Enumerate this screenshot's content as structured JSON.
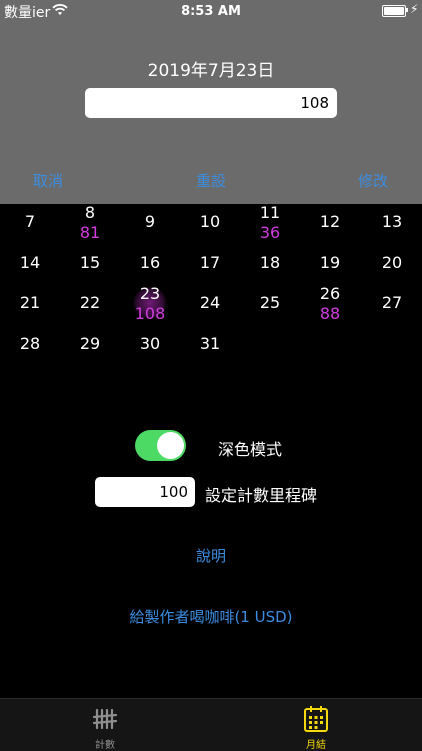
{
  "status_bar": {
    "carrier": "數量ier",
    "time": "8:53 AM"
  },
  "header": {
    "date": "2019年7月23日",
    "count_value": "108"
  },
  "actions": {
    "cancel": "取消",
    "reset": "重設",
    "modify": "修改"
  },
  "calendar": {
    "days": [
      {
        "day": "7",
        "count": ""
      },
      {
        "day": "8",
        "count": "81"
      },
      {
        "day": "9",
        "count": ""
      },
      {
        "day": "10",
        "count": ""
      },
      {
        "day": "11",
        "count": "36"
      },
      {
        "day": "12",
        "count": ""
      },
      {
        "day": "13",
        "count": ""
      },
      {
        "day": "14",
        "count": ""
      },
      {
        "day": "15",
        "count": ""
      },
      {
        "day": "16",
        "count": ""
      },
      {
        "day": "17",
        "count": ""
      },
      {
        "day": "18",
        "count": ""
      },
      {
        "day": "19",
        "count": ""
      },
      {
        "day": "20",
        "count": ""
      },
      {
        "day": "21",
        "count": ""
      },
      {
        "day": "22",
        "count": ""
      },
      {
        "day": "23",
        "count": "108"
      },
      {
        "day": "24",
        "count": ""
      },
      {
        "day": "25",
        "count": ""
      },
      {
        "day": "26",
        "count": "88"
      },
      {
        "day": "27",
        "count": ""
      },
      {
        "day": "28",
        "count": ""
      },
      {
        "day": "29",
        "count": ""
      },
      {
        "day": "30",
        "count": ""
      },
      {
        "day": "31",
        "count": ""
      }
    ],
    "selected_day": "23"
  },
  "settings": {
    "dark_mode_label": "深色模式",
    "dark_mode_on": true,
    "milestone_value": "100",
    "milestone_label": "設定計數里程碑",
    "help_link": "說明",
    "coffee_link": "給製作者喝咖啡(1 USD)"
  },
  "tabs": [
    {
      "label": "計數",
      "icon": "tally-icon",
      "active": false
    },
    {
      "label": "月結",
      "icon": "calendar-icon",
      "active": true
    }
  ],
  "colors": {
    "accent": "#3c8de0",
    "count": "#d23de0",
    "active_tab": "#f5d90a",
    "toggle_on": "#4cd964",
    "panel": "#6b6b6b"
  }
}
